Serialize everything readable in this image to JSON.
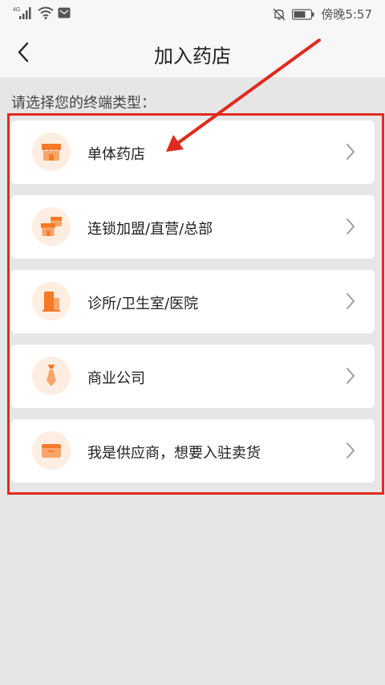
{
  "status_bar": {
    "signal_text": "4G",
    "time": "傍晚5:57"
  },
  "nav": {
    "title": "加入药店"
  },
  "section_label": "请选择您的终端类型：",
  "options": [
    {
      "label": "单体药店",
      "icon": "storefront-icon"
    },
    {
      "label": "连锁加盟/直营/总部",
      "icon": "chain-stores-icon"
    },
    {
      "label": "诊所/卫生室/医院",
      "icon": "clinic-building-icon"
    },
    {
      "label": "商业公司",
      "icon": "necktie-icon"
    },
    {
      "label": "我是供应商，想要入驻卖货",
      "icon": "supplier-box-icon"
    }
  ],
  "colors": {
    "accent": "#f47a28",
    "icon_bg": "#fdeee1",
    "annotation_red": "#e02a1f",
    "page_bg": "#e6e6e6"
  }
}
